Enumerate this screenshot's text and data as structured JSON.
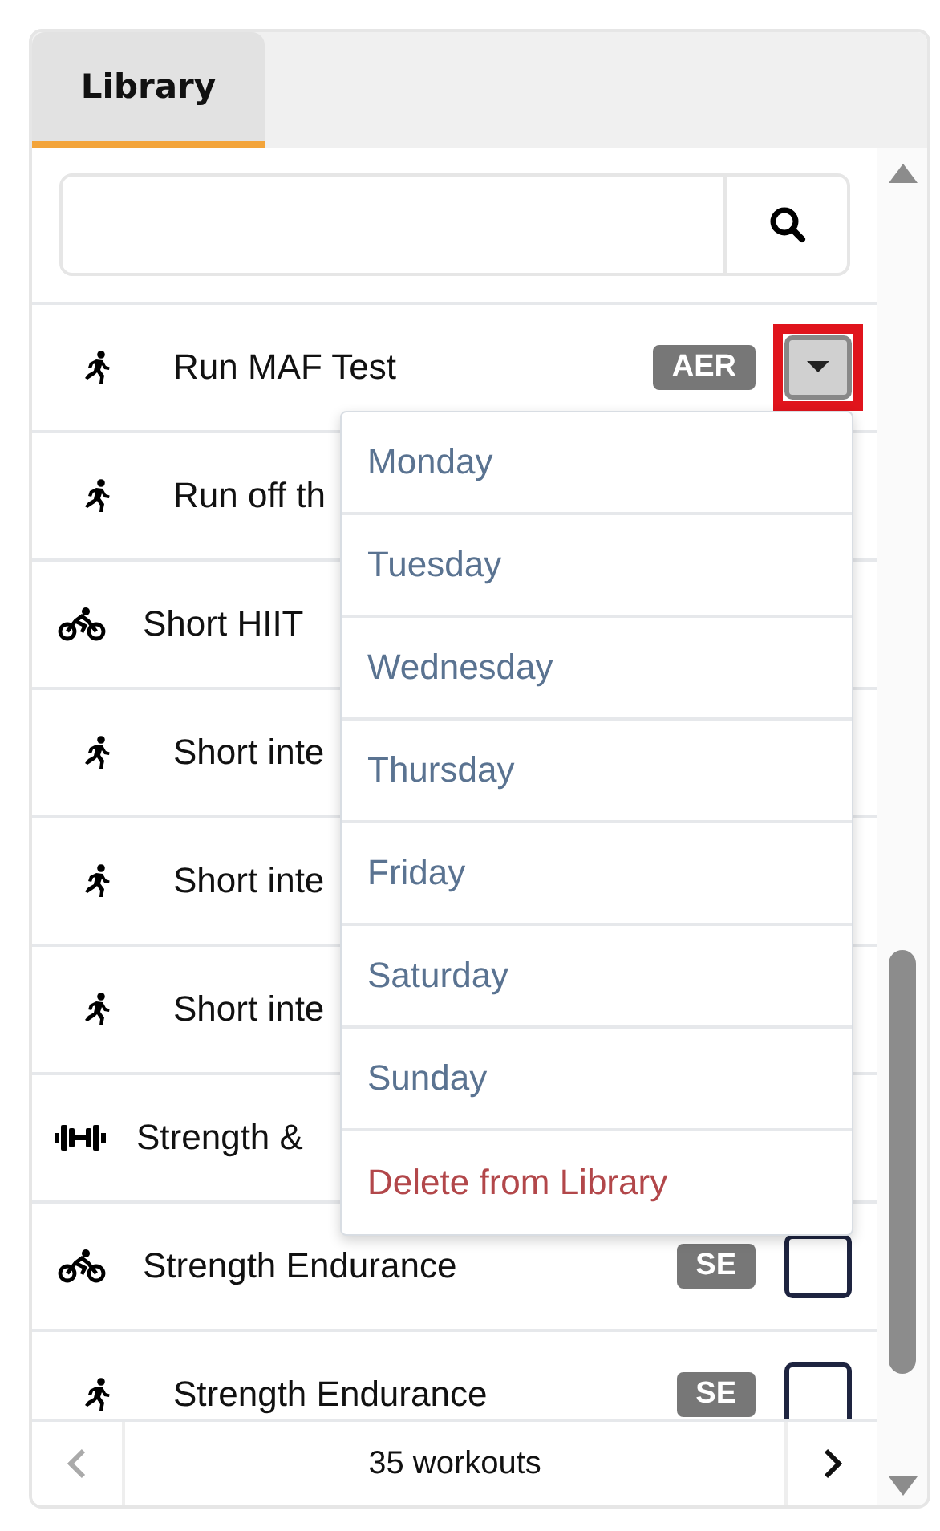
{
  "tabs": [
    {
      "label": "Library",
      "selected": true
    }
  ],
  "workouts": [
    {
      "kind": "run",
      "title": "Run MAF Test",
      "badge": "AER",
      "menu_button": {
        "open": true,
        "highlighted": true
      }
    },
    {
      "kind": "run",
      "title": "Run off th"
    },
    {
      "kind": "bike",
      "title": "Short HIIT"
    },
    {
      "kind": "run",
      "title": "Short inte"
    },
    {
      "kind": "run",
      "title": "Short inte"
    },
    {
      "kind": "run",
      "title": "Short inte"
    },
    {
      "kind": "weights",
      "title": "Strength &"
    },
    {
      "kind": "bike",
      "title": "Strength Endurance",
      "badge": "SE",
      "menu_button": {
        "open": false,
        "highlighted": false
      }
    },
    {
      "kind": "run",
      "title": "Strength Endurance",
      "badge": "SE",
      "menu_button": {
        "open": false,
        "highlighted": false
      }
    }
  ],
  "menu": [
    {
      "kind": "day",
      "label": "Monday"
    },
    {
      "kind": "day",
      "label": "Tuesday"
    },
    {
      "kind": "day",
      "label": "Wednesday"
    },
    {
      "kind": "day",
      "label": "Thursday"
    },
    {
      "kind": "day",
      "label": "Friday"
    },
    {
      "kind": "day",
      "label": "Saturday"
    },
    {
      "kind": "day",
      "label": "Sunday"
    },
    {
      "kind": "danger",
      "label": "Delete from Library"
    }
  ],
  "footer": {
    "count": "35 workouts",
    "prev_disabled": true,
    "next_disabled": false
  }
}
